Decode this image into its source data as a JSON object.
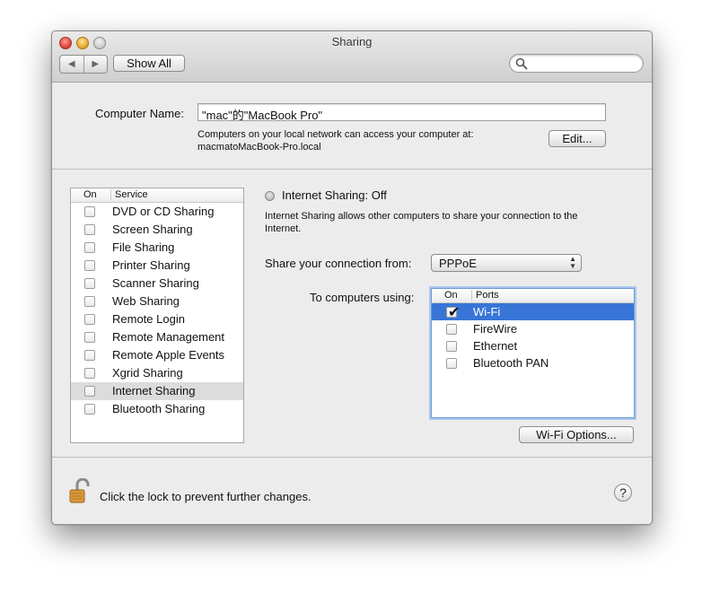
{
  "window": {
    "title": "Sharing"
  },
  "toolbar": {
    "back_glyph": "◀",
    "forward_glyph": "▶",
    "show_all_label": "Show All",
    "search_placeholder": ""
  },
  "header": {
    "computer_name_label": "Computer Name:",
    "computer_name_value": "\"mac\"的\"MacBook Pro\"",
    "description": "Computers on your local network can access your computer at:",
    "hostname": "macmatoMacBook-Pro.local",
    "edit_label": "Edit..."
  },
  "services": {
    "col_on": "On",
    "col_service": "Service",
    "items": [
      {
        "label": "DVD or CD Sharing",
        "checked": false,
        "selected": false
      },
      {
        "label": "Screen Sharing",
        "checked": false,
        "selected": false
      },
      {
        "label": "File Sharing",
        "checked": false,
        "selected": false
      },
      {
        "label": "Printer Sharing",
        "checked": false,
        "selected": false
      },
      {
        "label": "Scanner Sharing",
        "checked": false,
        "selected": false
      },
      {
        "label": "Web Sharing",
        "checked": false,
        "selected": false
      },
      {
        "label": "Remote Login",
        "checked": false,
        "selected": false
      },
      {
        "label": "Remote Management",
        "checked": false,
        "selected": false
      },
      {
        "label": "Remote Apple Events",
        "checked": false,
        "selected": false
      },
      {
        "label": "Xgrid Sharing",
        "checked": false,
        "selected": false
      },
      {
        "label": "Internet Sharing",
        "checked": false,
        "selected": true
      },
      {
        "label": "Bluetooth Sharing",
        "checked": false,
        "selected": false
      }
    ]
  },
  "detail": {
    "status_text": "Internet Sharing: Off",
    "description_line1": "Internet Sharing allows other computers to share your connection to the",
    "description_line2": "Internet.",
    "share_from_label": "Share your connection from:",
    "share_from_value": "PPPoE",
    "to_computers_label": "To computers using:",
    "ports_col_on": "On",
    "ports_col_ports": "Ports",
    "ports": [
      {
        "label": "Wi-Fi",
        "checked": true,
        "selected": true
      },
      {
        "label": "FireWire",
        "checked": false,
        "selected": false
      },
      {
        "label": "Ethernet",
        "checked": false,
        "selected": false
      },
      {
        "label": "Bluetooth PAN",
        "checked": false,
        "selected": false
      }
    ],
    "wifi_options_label": "Wi-Fi Options..."
  },
  "footer": {
    "lock_text": "Click the lock to prevent further changes.",
    "help_glyph": "?"
  },
  "colors": {
    "selection_blue": "#3875d7",
    "selection_gray": "#dcdcdc",
    "window_bg": "#ececec"
  }
}
